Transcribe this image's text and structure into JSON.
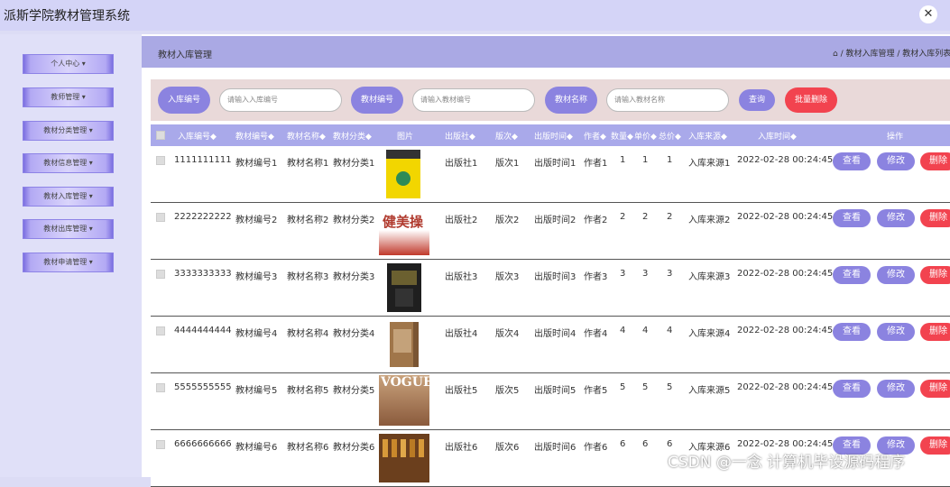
{
  "app_title": "派斯学院教材管理系统",
  "close_glyph": "✕",
  "sidebar": {
    "items": [
      {
        "label": "个人中心 ▾"
      },
      {
        "label": "教师管理 ▾"
      },
      {
        "label": "教材分类管理 ▾"
      },
      {
        "label": "教材信息管理 ▾"
      },
      {
        "label": "教材入库管理 ▾"
      },
      {
        "label": "教材出库管理 ▾"
      },
      {
        "label": "教材申请管理 ▾"
      }
    ]
  },
  "header": {
    "page_label": "教材入库管理",
    "breadcrumb": "⌂ / 教材入库管理 / 教材入库列表"
  },
  "search": {
    "f1_label": "入库编号",
    "f1_placeholder": "请输入入库编号",
    "f2_label": "教材编号",
    "f2_placeholder": "请输入教材编号",
    "f3_label": "教材名称",
    "f3_placeholder": "请输入教材名称",
    "query_label": "查询",
    "batch_delete_label": "批量删除"
  },
  "table": {
    "columns": [
      "入库编号◆",
      "教材编号◆",
      "教材名称◆",
      "教材分类◆",
      "图片",
      "出版社◆",
      "版次◆",
      "出版时间◆",
      "作者◆",
      "数量◆",
      "单价◆",
      "总价◆",
      "入库来源◆",
      "入库时间◆",
      "操作"
    ],
    "actions": {
      "view": "查看",
      "edit": "修改",
      "delete": "删除"
    },
    "rows": [
      {
        "id": "1111111111",
        "code": "教材编号1",
        "name": "教材名称1",
        "cat": "教材分类1",
        "img_text": "",
        "pub": "出版社1",
        "ver": "版次1",
        "date": "出版时间1",
        "author": "作者1",
        "qty": "1",
        "price": "1",
        "total": "1",
        "src": "入库来源1",
        "time": "2022-02-28 00:24:45"
      },
      {
        "id": "2222222222",
        "code": "教材编号2",
        "name": "教材名称2",
        "cat": "教材分类2",
        "img_text": "健美操",
        "pub": "出版社2",
        "ver": "版次2",
        "date": "出版时间2",
        "author": "作者2",
        "qty": "2",
        "price": "2",
        "total": "2",
        "src": "入库来源2",
        "time": "2022-02-28 00:24:45"
      },
      {
        "id": "3333333333",
        "code": "教材编号3",
        "name": "教材名称3",
        "cat": "教材分类3",
        "img_text": "",
        "pub": "出版社3",
        "ver": "版次3",
        "date": "出版时间3",
        "author": "作者3",
        "qty": "3",
        "price": "3",
        "total": "3",
        "src": "入库来源3",
        "time": "2022-02-28 00:24:45"
      },
      {
        "id": "4444444444",
        "code": "教材编号4",
        "name": "教材名称4",
        "cat": "教材分类4",
        "img_text": "",
        "pub": "出版社4",
        "ver": "版次4",
        "date": "出版时间4",
        "author": "作者4",
        "qty": "4",
        "price": "4",
        "total": "4",
        "src": "入库来源4",
        "time": "2022-02-28 00:24:45"
      },
      {
        "id": "5555555555",
        "code": "教材编号5",
        "name": "教材名称5",
        "cat": "教材分类5",
        "img_text": "VOGUE",
        "pub": "出版社5",
        "ver": "版次5",
        "date": "出版时间5",
        "author": "作者5",
        "qty": "5",
        "price": "5",
        "total": "5",
        "src": "入库来源5",
        "time": "2022-02-28 00:24:45"
      },
      {
        "id": "6666666666",
        "code": "教材编号6",
        "name": "教材名称6",
        "cat": "教材分类6",
        "img_text": "",
        "pub": "出版社6",
        "ver": "版次6",
        "date": "出版时间6",
        "author": "作者6",
        "qty": "6",
        "price": "6",
        "total": "6",
        "src": "入库来源6",
        "time": "2022-02-28 00:24:45"
      }
    ]
  },
  "watermark": "CSDN @一念 计算机毕设源码程序"
}
